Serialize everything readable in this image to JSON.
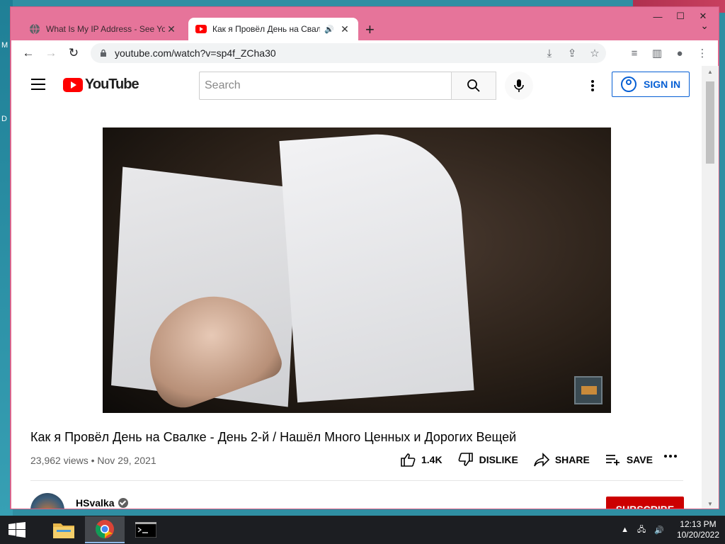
{
  "desktop": {
    "left_letters": [
      "M",
      "D"
    ]
  },
  "window_controls": {
    "minimize": "—",
    "maximize": "☐",
    "close": "✕"
  },
  "tabs": [
    {
      "title": "What Is My IP Address - See Your",
      "active": false
    },
    {
      "title": "Как я Провёл День на Свал",
      "active": true
    }
  ],
  "new_tab": "+",
  "tab_search": "⌄",
  "toolbar": {
    "url": "youtube.com/watch?v=sp4f_ZCha30"
  },
  "youtube": {
    "logo_text": "YouTube",
    "search_placeholder": "Search",
    "sign_in": "SIGN IN"
  },
  "video": {
    "title": "Как я Провёл День на Свалке - День 2-й / Нашёл Много Ценных и Дорогих Вещей",
    "views": "23,962 views",
    "date": "Nov 29, 2021",
    "likes": "1.4K",
    "dislike": "DISLIKE",
    "share": "SHARE",
    "save": "SAVE"
  },
  "channel": {
    "name": "HSvalka",
    "subscribe": "SUBSCRIBE"
  },
  "taskbar": {
    "clock_time": "12:13 PM",
    "clock_date": "10/20/2022"
  },
  "colors": {
    "window_frame": "#e6749a",
    "youtube_red": "#ff0000",
    "link_blue": "#065fd4",
    "subscribe_red": "#cc0000",
    "taskbar": "#1c1e22"
  }
}
